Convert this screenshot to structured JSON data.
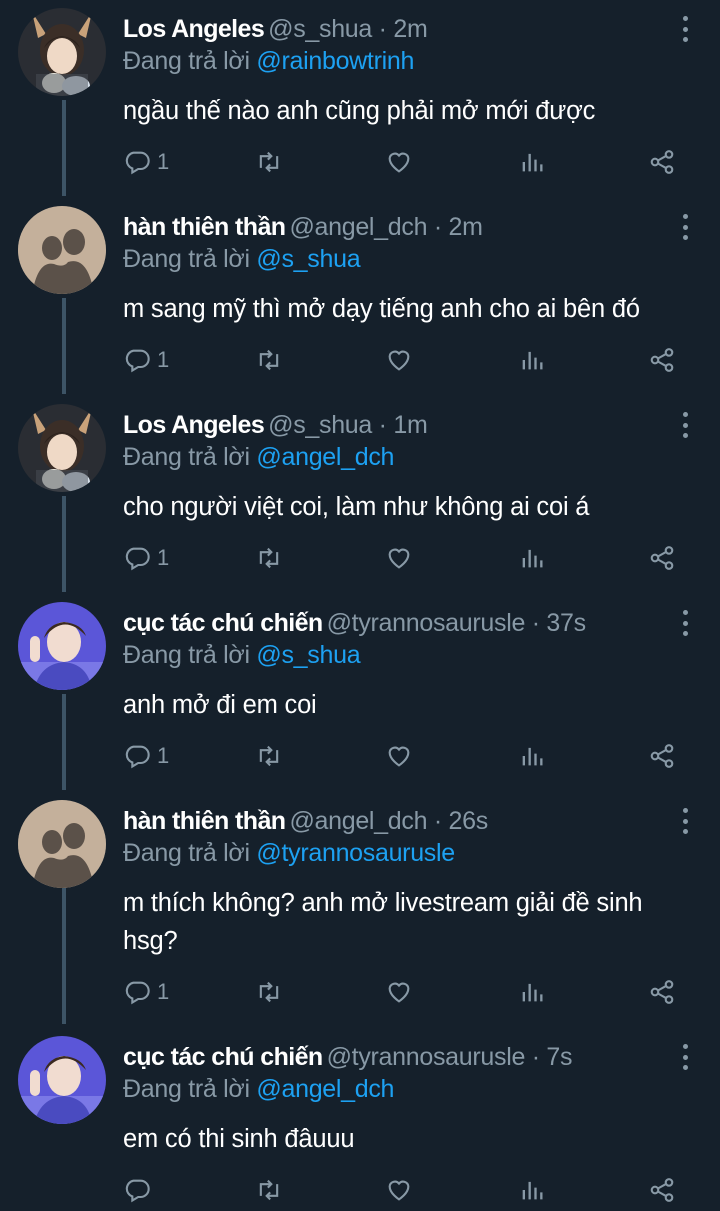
{
  "tweets": [
    {
      "name": "Los Angeles",
      "handle": "@s_shua · 2m",
      "reply_prefix": "Đang trả lời",
      "reply_to": "@rainbowtrinh",
      "text": "ngầu thế nào anh cũng phải mở mới được",
      "reply_count": "1",
      "avatar": "cat-ears"
    },
    {
      "name": "hàn thiên thần",
      "handle": "@angel_dch · 2m",
      "reply_prefix": "Đang trả lời",
      "reply_to": "@s_shua",
      "text": "m sang mỹ thì mở dạy tiếng anh cho ai bên đó",
      "reply_count": "1",
      "avatar": "shadow"
    },
    {
      "name": "Los Angeles",
      "handle": "@s_shua · 1m",
      "reply_prefix": "Đang trả lời",
      "reply_to": "@angel_dch",
      "text": "cho người việt coi, làm như không ai coi á",
      "reply_count": "1",
      "avatar": "cat-ears"
    },
    {
      "name": "cục tác chú chiến",
      "handle": "@tyrannosaurusle · 37s",
      "reply_prefix": "Đang trả lời",
      "reply_to": "@s_shua",
      "text": "anh mở đi em coi",
      "reply_count": "1",
      "avatar": "purple"
    },
    {
      "name": "hàn thiên thần",
      "handle": "@angel_dch · 26s",
      "reply_prefix": "Đang trả lời",
      "reply_to": "@tyrannosaurusle",
      "text": "m thích không? anh mở livestream giải đề sinh hsg?",
      "reply_count": "1",
      "avatar": "shadow"
    },
    {
      "name": "cục tác chú chiến",
      "handle": "@tyrannosaurusle · 7s",
      "reply_prefix": "Đang trả lời",
      "reply_to": "@angel_dch",
      "text": "em có thi sinh đâuuu",
      "reply_count": "",
      "avatar": "purple"
    }
  ],
  "colors": {
    "background": "#15202b",
    "secondary_text": "#8899a6",
    "link": "#1da1f2",
    "thread_line": "#3d5466"
  },
  "icons": [
    "reply-icon",
    "retweet-icon",
    "like-icon",
    "analytics-icon",
    "share-icon",
    "more-icon"
  ]
}
